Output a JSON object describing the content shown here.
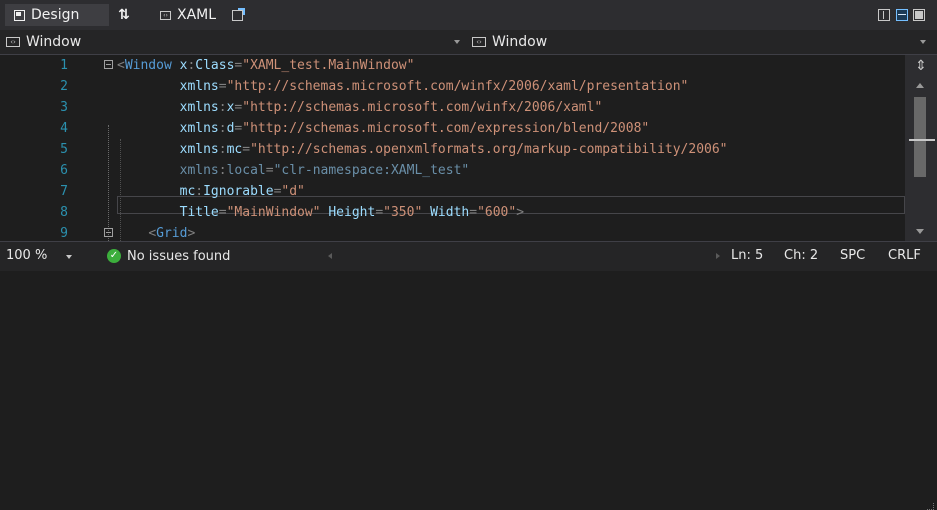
{
  "tabs": {
    "design": "Design",
    "swap_icon": "⇅",
    "xaml": "XAML",
    "xaml_icon": "‹›"
  },
  "nav": {
    "left": "Window",
    "right": "Window",
    "icon": "‹›"
  },
  "code_lines": [
    {
      "n": "1",
      "text": "<Window x:Class=\"XAML_test.MainWindow\""
    },
    {
      "n": "2",
      "text": "        xmlns=\"http://schemas.microsoft.com/winfx/2006/xaml/presentation\""
    },
    {
      "n": "3",
      "text": "        xmlns:x=\"http://schemas.microsoft.com/winfx/2006/xaml\""
    },
    {
      "n": "4",
      "text": "        xmlns:d=\"http://schemas.microsoft.com/expression/blend/2008\""
    },
    {
      "n": "5",
      "text": "        xmlns:mc=\"http://schemas.openxmlformats.org/markup-compatibility/2006\""
    },
    {
      "n": "6",
      "text": "        xmlns:local=\"clr-namespace:XAML_test\""
    },
    {
      "n": "7",
      "text": "        mc:Ignorable=\"d\""
    },
    {
      "n": "8",
      "text": "        Title=\"MainWindow\" Height=\"350\" Width=\"600\">"
    },
    {
      "n": "9",
      "text": "    <Grid>"
    }
  ],
  "status": {
    "zoom": "100 %",
    "issues": "No issues found",
    "check_icon": "✓",
    "line": "Ln: 5",
    "col": "Ch: 2",
    "spacing": "SPC",
    "eol": "CRLF"
  },
  "colors": {
    "background": "#1e1e1e",
    "line_number": "#2b91af",
    "tag": "#569cd6",
    "attribute": "#9cdcfe",
    "string": "#ce9178",
    "punctuation": "#808080",
    "faded_attribute": "#6a8fa8"
  }
}
